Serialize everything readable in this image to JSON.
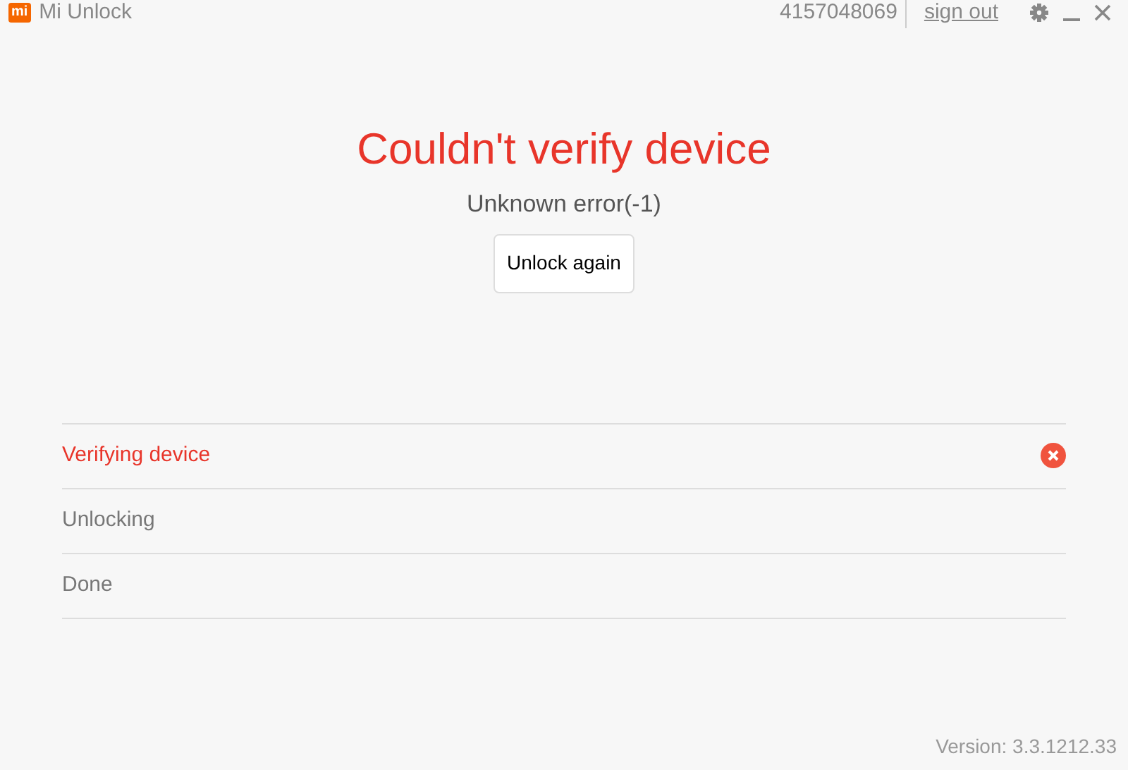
{
  "window": {
    "logo": "mi",
    "title": "Mi Unlock",
    "account": "4157048069",
    "sign_out": "sign out"
  },
  "heading": "Couldn't verify device",
  "message": "Unknown error(-1)",
  "button": "Unlock again",
  "steps": [
    {
      "label": "Verifying device",
      "kind": "failed"
    },
    {
      "label": "Unlocking",
      "kind": "pending"
    },
    {
      "label": "Done",
      "kind": "pending"
    }
  ],
  "version": "Version: 3.3.1212.33"
}
